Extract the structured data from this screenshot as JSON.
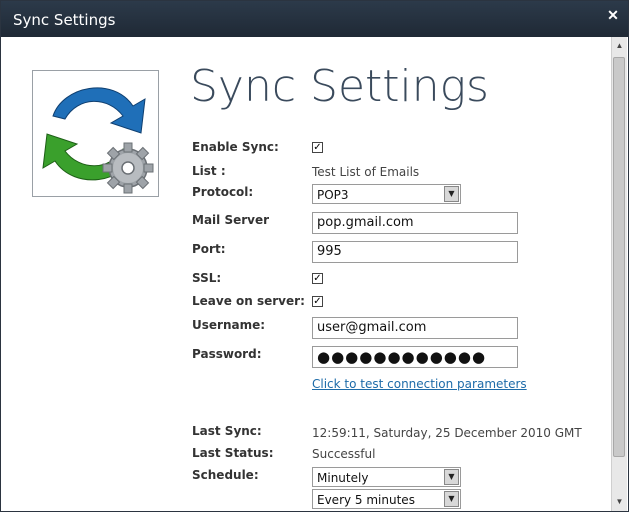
{
  "window": {
    "title": "Sync Settings",
    "close_glyph": "✕"
  },
  "heading": "Sync Settings",
  "logo": {
    "icon": "sync-gear-icon"
  },
  "form": {
    "enable_sync": {
      "label": "Enable Sync:",
      "checked": true
    },
    "list": {
      "label": "List :",
      "value": "Test List of Emails"
    },
    "protocol": {
      "label": "Protocol:",
      "value": "POP3"
    },
    "mail_server": {
      "label": "Mail Server",
      "value": "pop.gmail.com"
    },
    "port": {
      "label": "Port:",
      "value": "995"
    },
    "ssl": {
      "label": "SSL:",
      "checked": true
    },
    "leave_on_server": {
      "label": "Leave on server:",
      "checked": true
    },
    "username": {
      "label": "Username:",
      "value": "user@gmail.com"
    },
    "password": {
      "label": "Password:",
      "value": "●●●●●●●●●●●●"
    },
    "test_link": "Click to test connection parameters",
    "last_sync": {
      "label": "Last Sync:",
      "value": "12:59:11, Saturday, 25 December 2010 GMT"
    },
    "last_status": {
      "label": "Last Status:",
      "value": "Successful"
    },
    "schedule": {
      "label": "Schedule:",
      "value": "Minutely"
    },
    "interval": {
      "value": "Every 5 minutes"
    }
  },
  "colors": {
    "titlebar": "#1f2935",
    "heading": "#3a4a5c",
    "link": "#1d6ba8"
  }
}
